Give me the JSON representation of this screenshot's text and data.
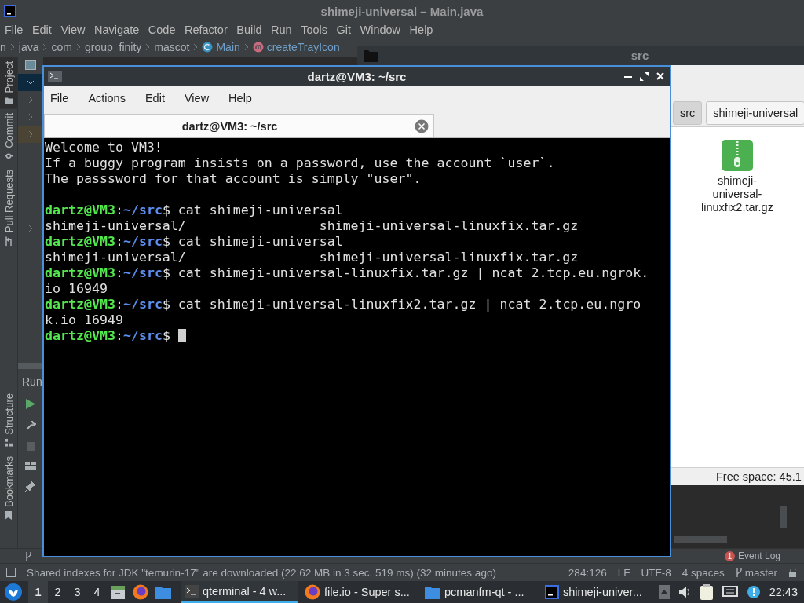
{
  "ide": {
    "title": "shimeji-universal – Main.java",
    "menu": [
      "File",
      "Edit",
      "View",
      "Navigate",
      "Code",
      "Refactor",
      "Build",
      "Run",
      "Tools",
      "Git",
      "Window",
      "Help"
    ],
    "breadcrumb": [
      {
        "text": "n",
        "kind": "folder"
      },
      {
        "text": "java",
        "kind": "folder"
      },
      {
        "text": "com",
        "kind": "folder"
      },
      {
        "text": "group_finity",
        "kind": "folder"
      },
      {
        "text": "mascot",
        "kind": "folder"
      },
      {
        "text": "Main",
        "kind": "class"
      },
      {
        "text": "createTrayIcon",
        "kind": "method"
      }
    ],
    "tool_windows": [
      {
        "label": "Project",
        "kind": "project",
        "selected": true
      },
      {
        "label": "Commit",
        "kind": "commit",
        "selected": false
      },
      {
        "label": "Pull Requests",
        "kind": "pull_requests",
        "selected": false
      }
    ],
    "bottom_tool_windows": [
      {
        "label": "Structure",
        "kind": "structure",
        "selected": false
      },
      {
        "label": "Bookmarks",
        "kind": "bookmarks",
        "selected": false
      }
    ],
    "run_panel": {
      "title": "Run"
    },
    "event_log": {
      "badge": "1",
      "label": "Event Log"
    },
    "status_bar": {
      "message": "Shared indexes for JDK \"temurin-17\" are downloaded (22.62 MB in 3 sec, 519 ms) (32 minutes ago)",
      "position": "284:126",
      "line_separator": "LF",
      "encoding": "UTF-8",
      "indent": "4 spaces",
      "branch": "master"
    }
  },
  "file_manager": {
    "title": "src",
    "path": [
      {
        "label": "src",
        "selected": true
      },
      {
        "label": "shimeji-universal",
        "selected": false
      }
    ],
    "files": [
      {
        "name": "shimeji-universal-linuxfix2.tar.gz",
        "kind": "archive"
      }
    ],
    "status": "Free space: 45.1"
  },
  "terminal": {
    "title": "dartz@VM3: ~/src",
    "menu": [
      "File",
      "Actions",
      "Edit",
      "View",
      "Help"
    ],
    "tabs": [
      {
        "label": "dartz@VM3: ~/src",
        "selected": true
      }
    ],
    "lines": [
      {
        "kind": "output",
        "text": "Welcome to VM3!"
      },
      {
        "kind": "output",
        "text": "If a buggy program insists on a password, use the account `user`."
      },
      {
        "kind": "output",
        "text": "The passsword for that account is simply \"user\"."
      },
      {
        "kind": "blank"
      },
      {
        "kind": "prompt",
        "user": "dartz@VM3",
        "separator": ":",
        "path": "~/src",
        "symbol": "$",
        "command": "cat shimeji-universal"
      },
      {
        "kind": "output",
        "text": "shimeji-universal/                 shimeji-universal-linuxfix.tar.gz"
      },
      {
        "kind": "prompt",
        "user": "dartz@VM3",
        "separator": ":",
        "path": "~/src",
        "symbol": "$",
        "command": "cat shimeji-universal"
      },
      {
        "kind": "output",
        "text": "shimeji-universal/                 shimeji-universal-linuxfix.tar.gz"
      },
      {
        "kind": "prompt",
        "user": "dartz@VM3",
        "separator": ":",
        "path": "~/src",
        "symbol": "$",
        "command": "cat shimeji-universal-linuxfix.tar.gz | ncat 2.tcp.eu.ngrok.io 16949"
      },
      {
        "kind": "prompt",
        "user": "dartz@VM3",
        "separator": ":",
        "path": "~/src",
        "symbol": "$",
        "command": "cat shimeji-universal-linuxfix2.tar.gz | ncat 2.tcp.eu.ngrok.io 16949"
      },
      {
        "kind": "prompt",
        "user": "dartz@VM3",
        "separator": ":",
        "path": "~/src",
        "symbol": "$",
        "cursor": true
      }
    ]
  },
  "taskbar": {
    "workspaces": [
      {
        "label": "1",
        "selected": true
      },
      {
        "label": "2",
        "selected": false
      },
      {
        "label": "3",
        "selected": false
      },
      {
        "label": "4",
        "selected": false
      }
    ],
    "tasks": [
      {
        "label": "qterminal - 4 w...",
        "kind": "terminal",
        "selected": true
      },
      {
        "label": "file.io - Super s...",
        "kind": "browser",
        "selected": false
      },
      {
        "label": "pcmanfm-qt - ...",
        "kind": "folder",
        "selected": false
      },
      {
        "label": "shimeji-univer...",
        "kind": "ide",
        "selected": false
      }
    ],
    "clock": "22:43"
  }
}
